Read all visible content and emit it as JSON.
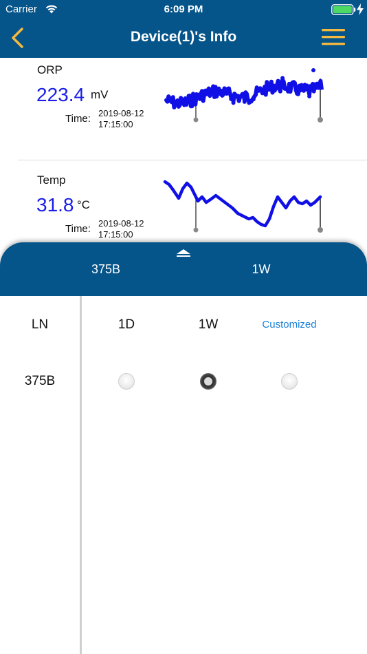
{
  "status_bar": {
    "carrier": "Carrier",
    "time": "6:09 PM",
    "battery_color": "#4cd964"
  },
  "nav": {
    "title": "Device(1)'s Info",
    "back_icon": "chevron-left-icon",
    "menu_icon": "hamburger-menu-icon",
    "accent_color": "#f4b940",
    "bar_color": "#05548a"
  },
  "sensors": [
    {
      "name": "ORP",
      "value": "223.4",
      "unit": "mV",
      "time_label": "Time:",
      "date": "2019-08-12",
      "clock": "17:15:00",
      "line_color": "#1010e6"
    },
    {
      "name": "Temp",
      "value": "31.8",
      "unit": "°C",
      "time_label": "Time:",
      "date": "2019-08-12",
      "clock": "17:15:00",
      "line_color": "#1010e6"
    }
  ],
  "sheet": {
    "selected_ln": "375B",
    "selected_range": "1W",
    "columns": {
      "ln": "LN",
      "d1": "1D",
      "w1": "1W",
      "custom": "Customized"
    },
    "rows": [
      {
        "ln": "375B",
        "selected": "1W"
      }
    ]
  }
}
